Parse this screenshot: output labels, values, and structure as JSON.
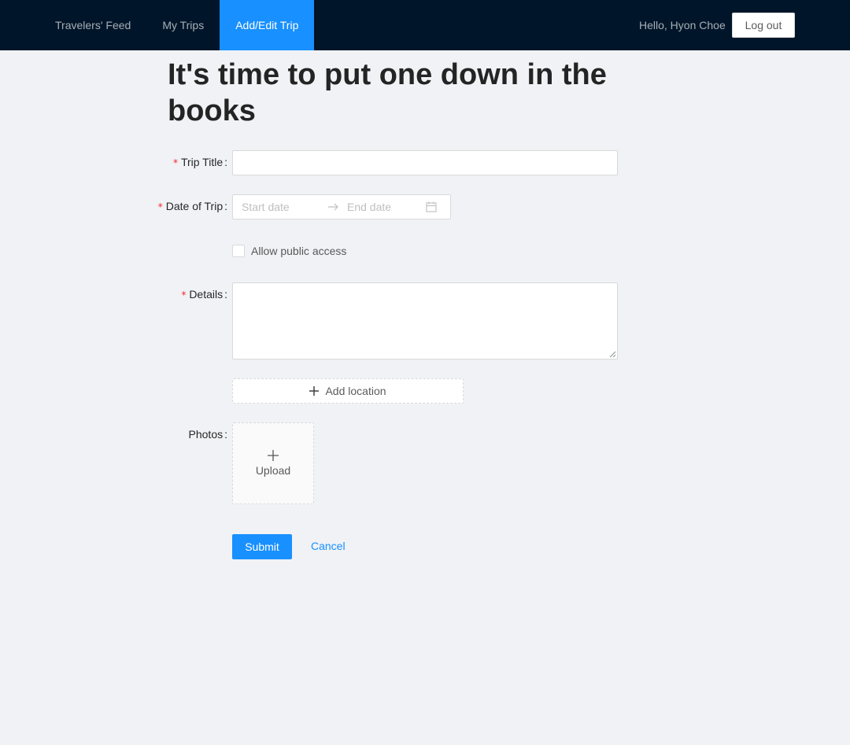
{
  "nav": {
    "items": [
      {
        "label": "Travelers' Feed"
      },
      {
        "label": "My Trips"
      },
      {
        "label": "Add/Edit Trip"
      }
    ],
    "greeting": "Hello, Hyon Choe",
    "logout_label": "Log out",
    "active_color": "#1890ff",
    "header_color": "#001529"
  },
  "page": {
    "title": "It's time to put one down in the books"
  },
  "form": {
    "required_mark": "*",
    "trip_title": {
      "label": "Trip Title",
      "value": ""
    },
    "date_of_trip": {
      "label": "Date of Trip",
      "start_placeholder": "Start date",
      "end_placeholder": "End date",
      "separator_icon": "arrow-right-icon",
      "calendar_icon": "calendar-icon"
    },
    "public_access": {
      "label": "Allow public access",
      "checked": false
    },
    "details": {
      "label": "Details",
      "value": ""
    },
    "add_location_label": "Add location",
    "photos": {
      "label": "Photos",
      "upload_label": "Upload"
    },
    "submit_label": "Submit",
    "cancel_label": "Cancel"
  }
}
